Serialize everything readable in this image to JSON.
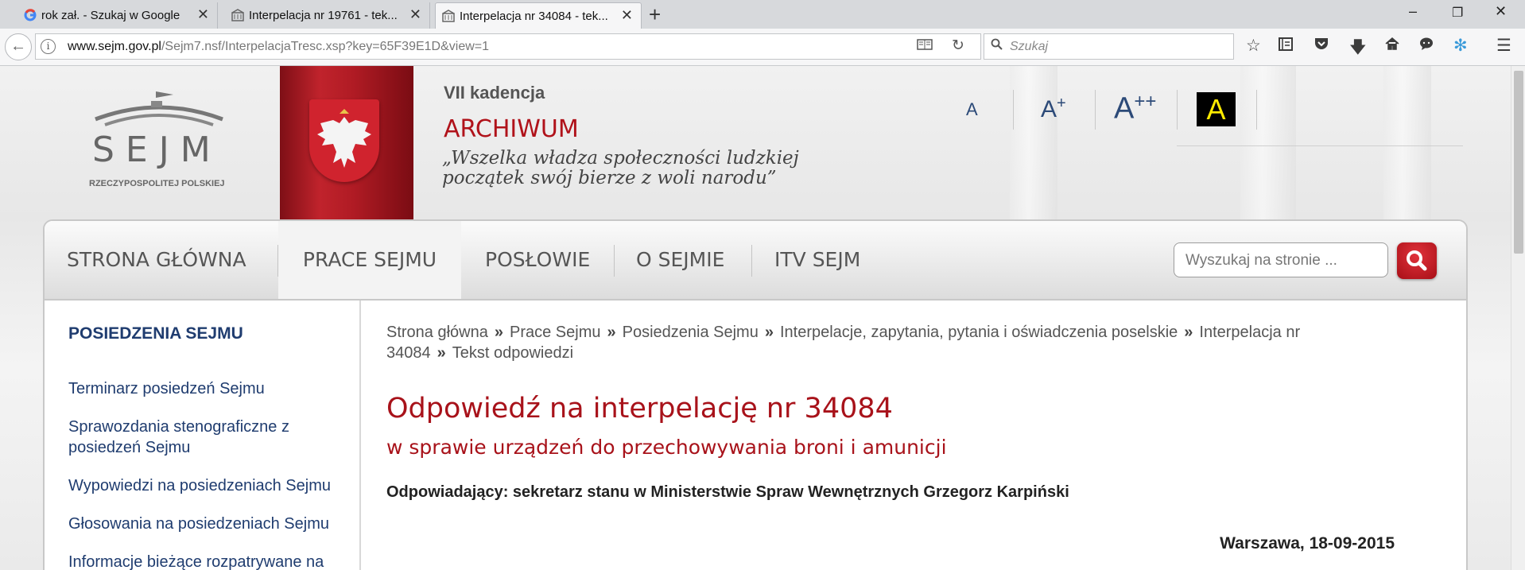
{
  "browser": {
    "tabs": [
      {
        "title": "rok zał. - Szukaj w Google",
        "icon": "google-icon",
        "active": false
      },
      {
        "title": "Interpelacja nr 19761 - tek...",
        "icon": "sejm-favicon",
        "active": false
      },
      {
        "title": "Interpelacja nr 34084 - tek...",
        "icon": "sejm-favicon",
        "active": true
      }
    ],
    "url_domain": "www.sejm.gov.pl",
    "url_path": "/Sejm7.nsf/InterpelacjaTresc.xsp?key=65F39E1D&view=1",
    "search_placeholder": "Szukaj",
    "window_controls": {
      "minimize": "–",
      "restore": "❐",
      "close": "✕"
    }
  },
  "header": {
    "logo_text": "SEJM",
    "logo_subtext": "RZECZYPOSPOLITEJ POLSKIEJ",
    "kadencja": "VII kadencja",
    "archiwum": "ARCHIWUM",
    "motto_line1": "„Wszelka władza społeczności ludzkiej",
    "motto_line2": "początek swój bierze z woli narodu”",
    "font_sizes": {
      "small": "A",
      "medium": "A",
      "medium_sup": "+",
      "large": "A",
      "large_sup": "++",
      "contrast": "A"
    }
  },
  "menu": {
    "items": [
      "STRONA GŁÓWNA",
      "PRACE SEJMU",
      "POSŁOWIE",
      "O SEJMIE",
      "ITV SEJM"
    ],
    "active_index": 1,
    "search_placeholder": "Wyszukaj na stronie ..."
  },
  "sidebar": {
    "title": "POSIEDZENIA SEJMU",
    "links": [
      "Terminarz posiedzeń Sejmu",
      "Sprawozdania stenograficzne z posiedzeń Sejmu",
      "Wypowiedzi na posiedzeniach Sejmu",
      "Głosowania na posiedzeniach Sejmu",
      "Informacje bieżące rozpatrywane na"
    ]
  },
  "content": {
    "breadcrumb": [
      "Strona główna",
      "Prace Sejmu",
      "Posiedzenia Sejmu",
      "Interpelacje, zapytania, pytania i oświadczenia poselskie",
      "Interpelacja nr 34084",
      "Tekst odpowiedzi"
    ],
    "breadcrumb_sep": "»",
    "title": "Odpowiedź na interpelację nr 34084",
    "subtitle": "w sprawie urządzeń do przechowywania broni i amunicji",
    "responder": "Odpowiadający: sekretarz stanu w Ministerstwie Spraw Wewnętrznych Grzegorz Karpiński",
    "place_date": "Warszawa, 18-09-2015"
  },
  "colors": {
    "accent_red": "#a8121a",
    "link_blue": "#1f3c6f",
    "contrast_yellow": "#ffeb00"
  }
}
